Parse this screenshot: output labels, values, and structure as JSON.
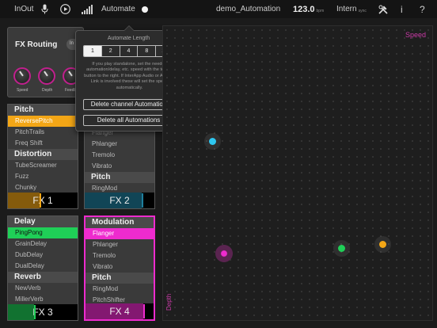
{
  "topbar": {
    "inout_label": "InOut",
    "automate_label": "Automate",
    "project_name": "demo_Automation",
    "tempo_value": "123.0",
    "tempo_unit": "bpm",
    "clock_label": "Intern",
    "clock_sub": "sync",
    "info_label": "i",
    "help_label": "?",
    "icons": [
      "mic-icon",
      "play-icon",
      "level-meter-icon",
      "record-dot-icon",
      "tools-icon"
    ]
  },
  "fx_routing": {
    "title": "FX Routing",
    "in_button": "In",
    "knobs": [
      {
        "label": "Speed"
      },
      {
        "label": "Depth"
      },
      {
        "label": "Feedb"
      }
    ],
    "accent_color": "#c0208d"
  },
  "automate_popover": {
    "title": "Automate Length",
    "lengths": [
      "1",
      "2",
      "4",
      "8",
      "16"
    ],
    "selected_length": "1",
    "note": "If you play standalone, set the needed automation/delay, etc. speed with the tempo button to the right. If InterApp Audio or Ableton Link is involved these will set the speed automatically.",
    "delete_channel_label": "Delete channel Automation",
    "delete_all_label": "Delete all Automations"
  },
  "fx_slots": [
    {
      "id": "fx1",
      "groups": [
        {
          "title": "Pitch",
          "items": [
            "ReversePitch",
            "PitchTrails",
            "Freq Shift"
          ]
        },
        {
          "title": "Distortion",
          "items": [
            "TubeScreamer",
            "Fuzz",
            "Chunky"
          ]
        }
      ],
      "selected": "ReversePitch",
      "footer": "FX 1",
      "color": "#f3a616",
      "level": 0.45
    },
    {
      "id": "fx2",
      "groups": [
        {
          "title": "",
          "items": [
            "Flanger",
            "Phlanger",
            "Tremolo",
            "Vibrato"
          ]
        },
        {
          "title": "Pitch",
          "items": [
            "RingMod"
          ]
        }
      ],
      "selected": "",
      "footer": "FX 2",
      "color": "#1f7e9c",
      "level": 0.82
    },
    {
      "id": "fx3",
      "groups": [
        {
          "title": "Delay",
          "items": [
            "PingPong",
            "GrainDelay",
            "DubDelay",
            "DualDelay"
          ]
        },
        {
          "title": "Reverb",
          "items": [
            "NewVerb",
            "MillerVerb"
          ]
        }
      ],
      "selected": "PingPong",
      "footer": "FX 3",
      "color": "#1fcf57",
      "level": 0.38
    },
    {
      "id": "fx4",
      "groups": [
        {
          "title": "Modulation",
          "items": [
            "Flanger",
            "Phlanger",
            "Tremolo",
            "Vibrato"
          ]
        },
        {
          "title": "Pitch",
          "items": [
            "RingMod",
            "PitchShifter"
          ]
        }
      ],
      "selected": "Flanger",
      "footer": "FX 4",
      "color": "#ee2bce",
      "level": 0.85
    }
  ],
  "xypad": {
    "x_axis_label": "Speed",
    "y_axis_label": "Depth",
    "label_color": "#c93aa6",
    "points": [
      {
        "name": "fx2-point",
        "color": "#2ec7f0"
      },
      {
        "name": "fx4-point",
        "color": "#ee2bce"
      },
      {
        "name": "fx3-point",
        "color": "#1fcf57"
      },
      {
        "name": "fx1-point",
        "color": "#f3a616"
      }
    ]
  }
}
